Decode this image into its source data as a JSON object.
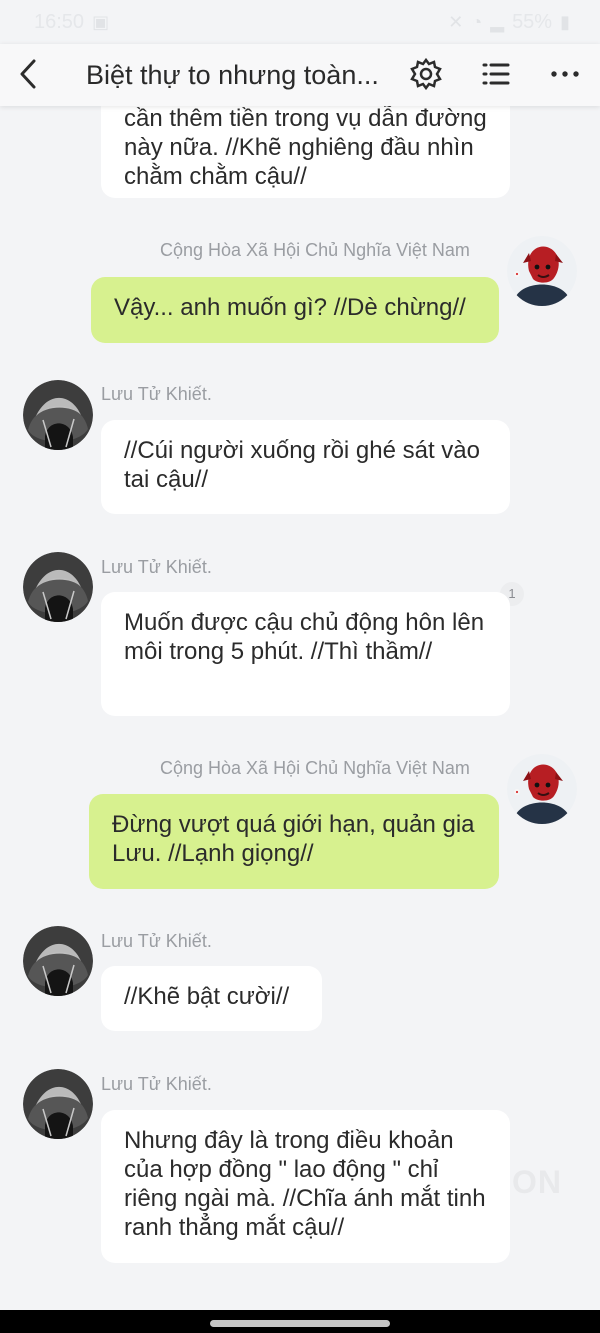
{
  "status": {
    "time": "16:50",
    "battery": "55%"
  },
  "header": {
    "title": "Biệt thự to nhưng toàn...",
    "icons": [
      "chevron-left-icon",
      "gear-icon",
      "list-icon",
      "more-icon"
    ]
  },
  "messages": [
    {
      "side": "left",
      "text": "cần thêm tiền trong vụ dẫn đường này nữa. //Khẽ nghiêng đầu nhìn chằm chằm cậu//"
    },
    {
      "side": "right",
      "sender": "Cộng Hòa Xã Hội Chủ Nghĩa Việt Nam",
      "text": "Vậy... anh muốn gì? //Dè chừng//"
    },
    {
      "side": "left",
      "sender": "Lưu Tử Khiết.",
      "text": "//Cúi người xuống rồi ghé sát vào tai cậu//"
    },
    {
      "side": "left",
      "sender": "Lưu Tử Khiết.",
      "text": "Muốn được cậu chủ động hôn lên môi trong 5 phút. //Thì thầm//",
      "read_count": "1"
    },
    {
      "side": "right",
      "sender": "Cộng Hòa Xã Hội Chủ Nghĩa Việt Nam",
      "text": "Đừng vượt quá giới hạn, quản gia Lưu. //Lạnh giọng//"
    },
    {
      "side": "left",
      "sender": "Lưu Tử Khiết.",
      "text": "//Khẽ bật cười//"
    },
    {
      "side": "left",
      "sender": "Lưu Tử Khiết.",
      "text": "Nhưng đây là trong điều khoản của hợp đồng \" lao động \" chỉ riêng ngài mà. //Chĩa ánh mắt tinh ranh thẳng mắt cậu//"
    }
  ],
  "watermark": "ON"
}
